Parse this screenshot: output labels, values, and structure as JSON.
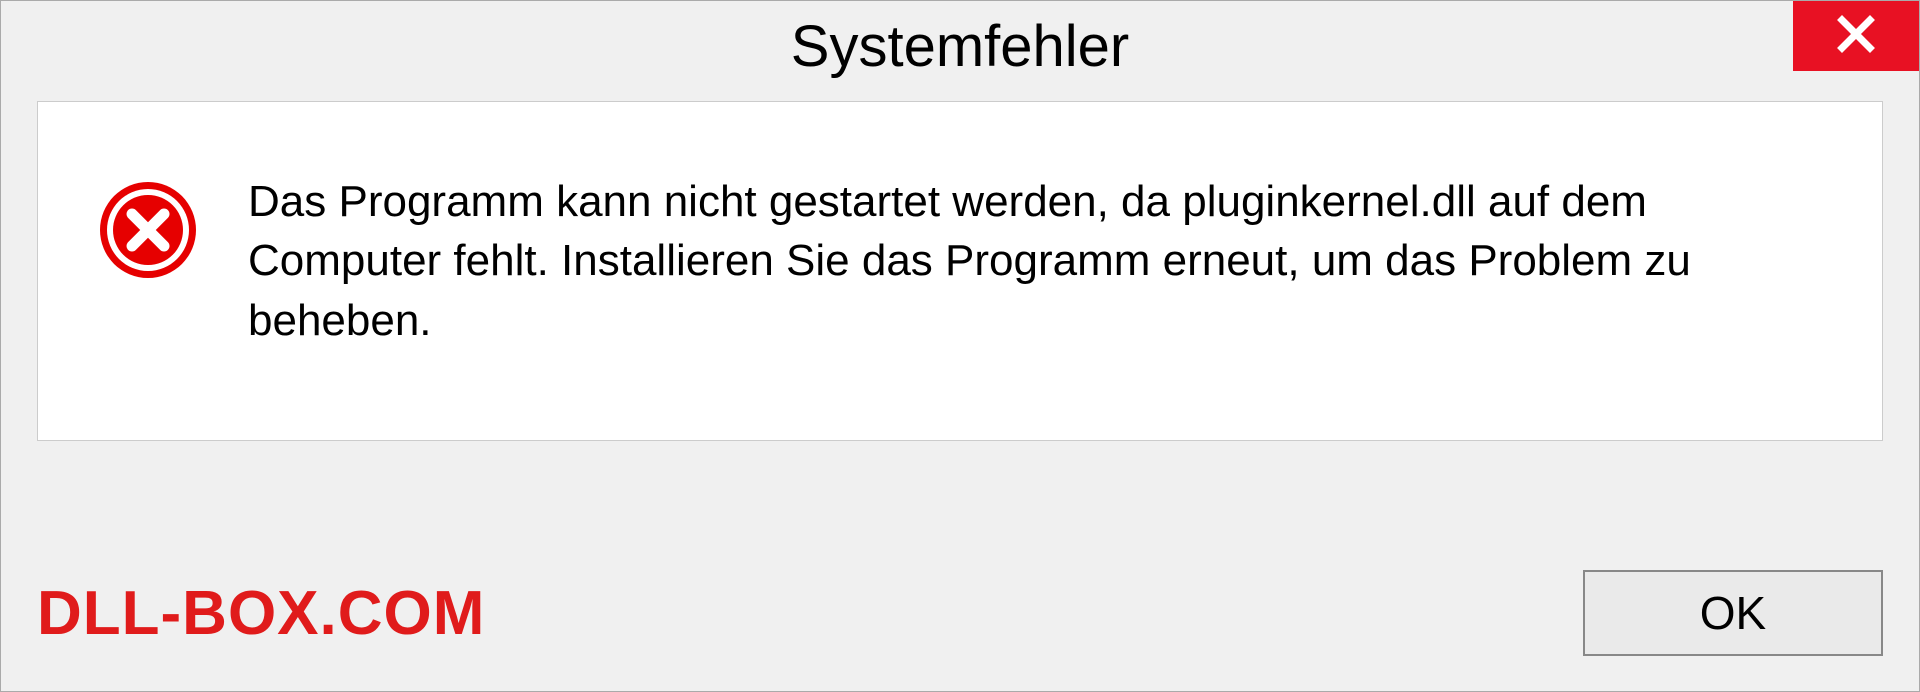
{
  "dialog": {
    "title": "Systemfehler",
    "message": "Das Programm kann nicht gestartet werden, da pluginkernel.dll auf dem Computer fehlt. Installieren Sie das Programm erneut, um das Problem zu beheben.",
    "ok_label": "OK"
  },
  "watermark": "DLL-BOX.COM"
}
